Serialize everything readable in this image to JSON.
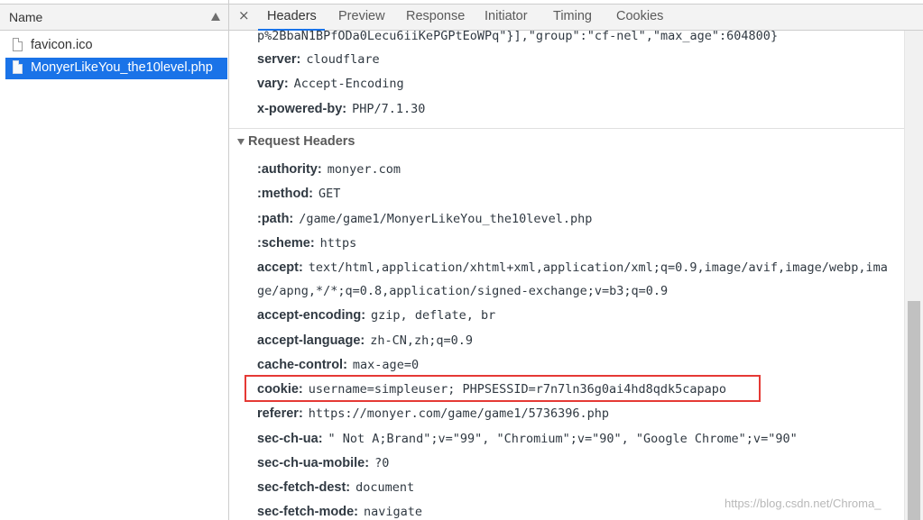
{
  "file_list": {
    "column_header": "Name",
    "files": [
      {
        "name": "favicon.ico",
        "selected": false
      },
      {
        "name": "MonyerLikeYou_the10level.php",
        "selected": true
      }
    ]
  },
  "tabs": {
    "close_glyph": "×",
    "items": [
      "Headers",
      "Preview",
      "Response",
      "Initiator",
      "Timing",
      "Cookies"
    ],
    "active": "Headers"
  },
  "response_headers": {
    "truncated_line": "p%2BbaN1BPfODa0Lecu6iiKePGPtEoWPq\"}],\"group\":\"cf-nel\",\"max_age\":604800}",
    "items": [
      {
        "name": "server:",
        "value": "cloudflare"
      },
      {
        "name": "vary:",
        "value": "Accept-Encoding"
      },
      {
        "name": "x-powered-by:",
        "value": "PHP/7.1.30"
      }
    ]
  },
  "request_headers": {
    "title": "Request Headers",
    "items": [
      {
        "name": ":authority:",
        "value": "monyer.com"
      },
      {
        "name": ":method:",
        "value": "GET"
      },
      {
        "name": ":path:",
        "value": "/game/game1/MonyerLikeYou_the10level.php"
      },
      {
        "name": ":scheme:",
        "value": "https"
      },
      {
        "name": "accept:",
        "value": "text/html,application/xhtml+xml,application/xml;q=0.9,image/avif,image/webp,ima",
        "continuation": "ge/apng,*/*;q=0.8,application/signed-exchange;v=b3;q=0.9"
      },
      {
        "name": "accept-encoding:",
        "value": "gzip, deflate, br"
      },
      {
        "name": "accept-language:",
        "value": "zh-CN,zh;q=0.9"
      },
      {
        "name": "cache-control:",
        "value": "max-age=0"
      },
      {
        "name": "cookie:",
        "value": "username=simpleuser; PHPSESSID=r7n7ln36g0ai4hd8qdk5capapo"
      },
      {
        "name": "referer:",
        "value": "https://monyer.com/game/game1/5736396.php"
      },
      {
        "name": "sec-ch-ua:",
        "value": "\" Not A;Brand\";v=\"99\", \"Chromium\";v=\"90\", \"Google Chrome\";v=\"90\""
      },
      {
        "name": "sec-ch-ua-mobile:",
        "value": "?0"
      },
      {
        "name": "sec-fetch-dest:",
        "value": "document"
      },
      {
        "name": "sec-fetch-mode:",
        "value": "navigate"
      }
    ]
  },
  "watermark": "https://blog.csdn.net/Chroma_",
  "colors": {
    "selection": "#1a73e8",
    "highlight_box": "#e53935"
  }
}
